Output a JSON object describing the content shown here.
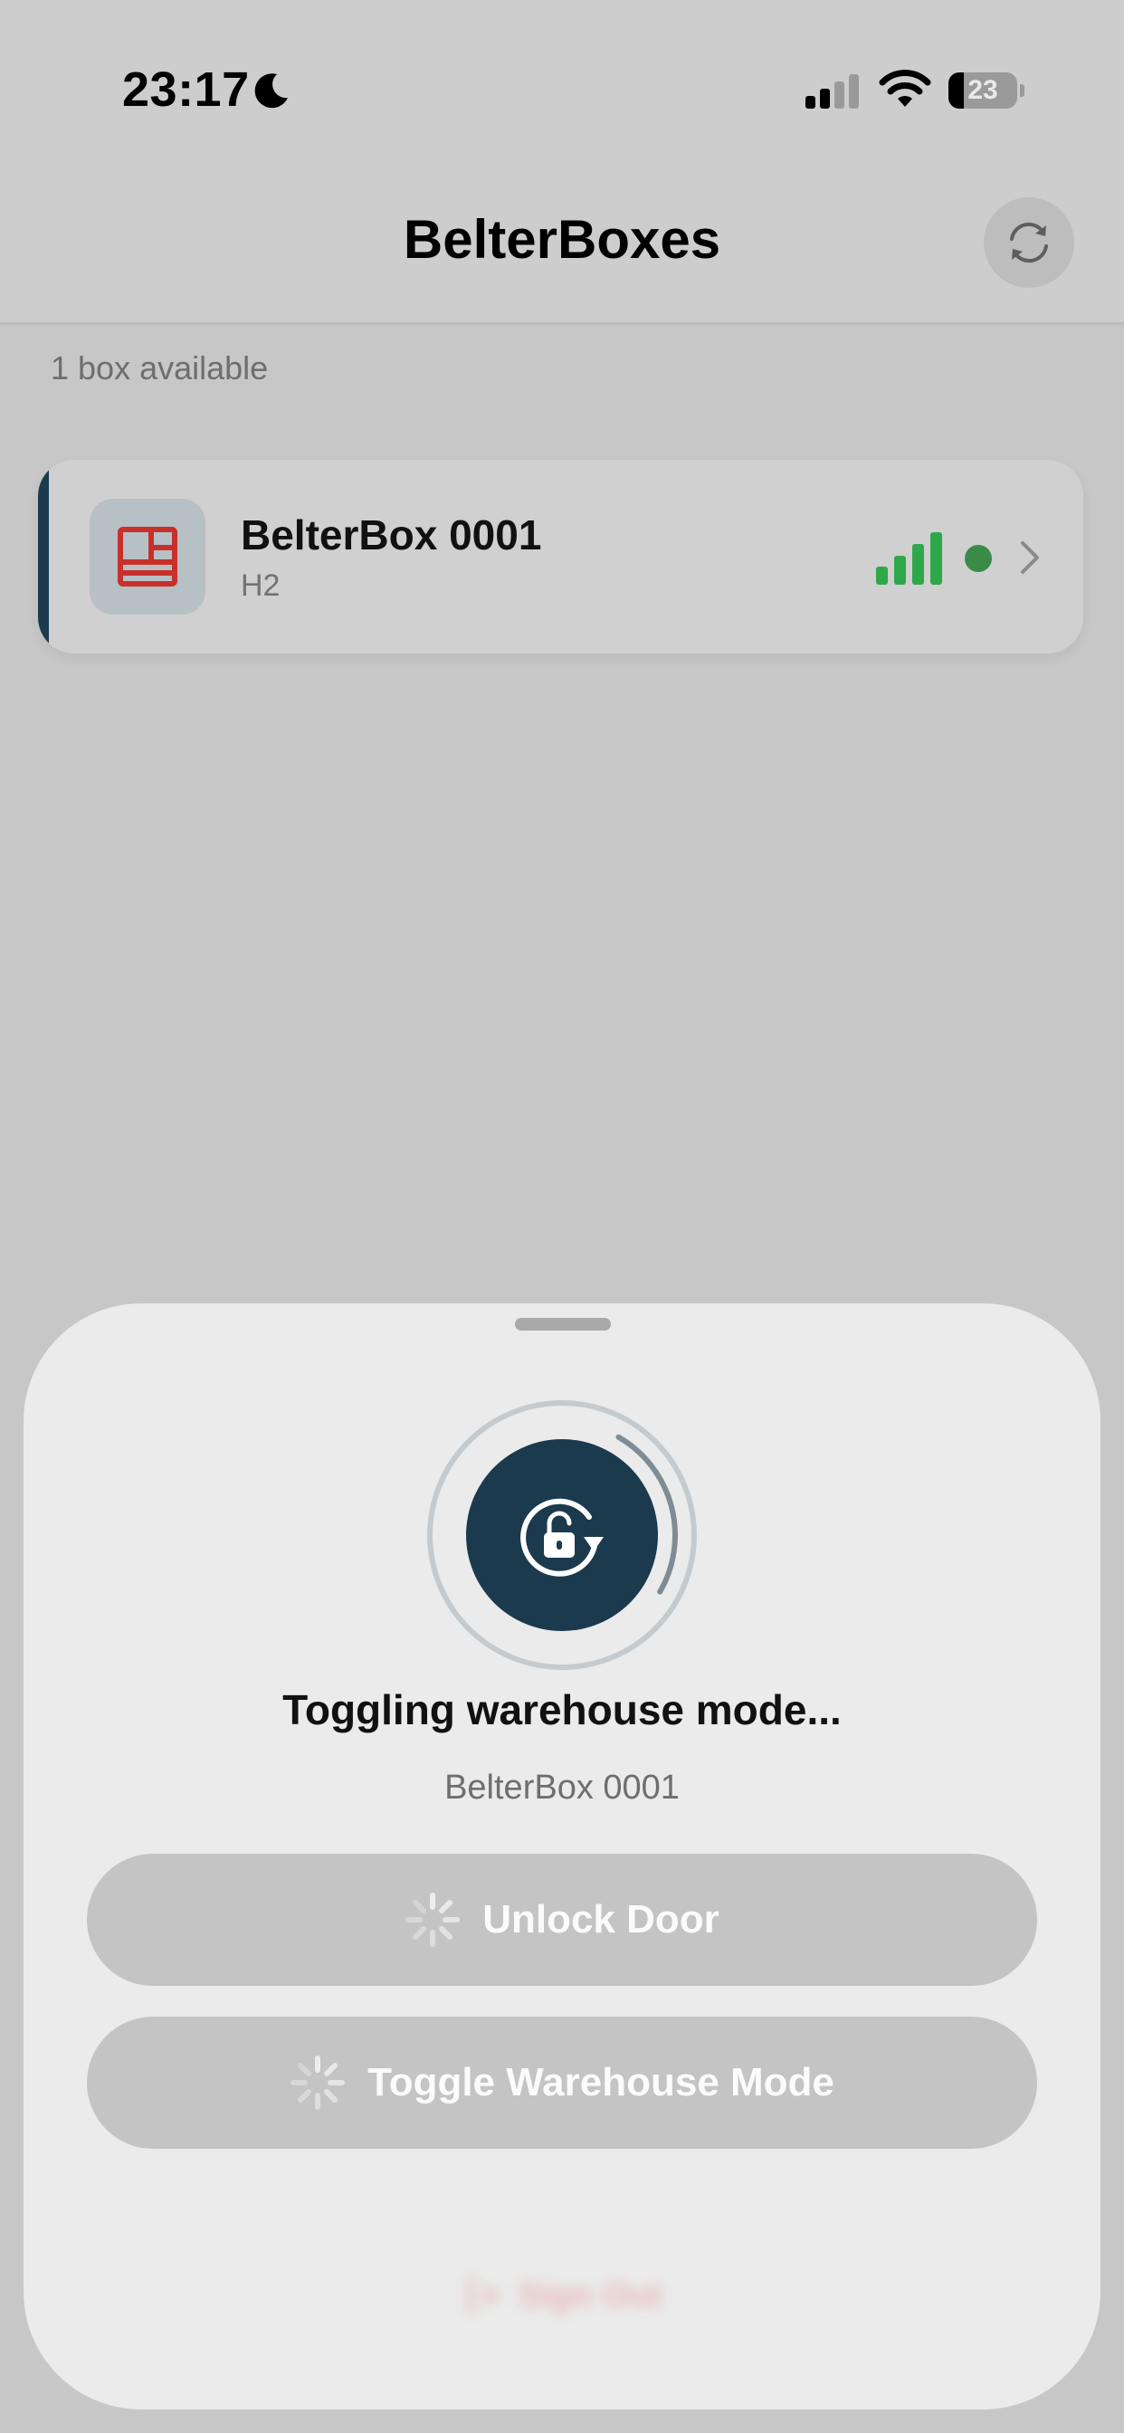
{
  "status_bar": {
    "time": "23:17",
    "battery": "23",
    "battery_fraction": 0.23,
    "cell_bars_active": 2,
    "cell_bars_total": 4
  },
  "header": {
    "title": "BelterBoxes",
    "refresh_icon": "refresh-icon"
  },
  "list": {
    "count_text": "1 box available",
    "boxes": [
      {
        "name": "BelterBox 0001",
        "model": "H2",
        "icon": "box-layout-icon",
        "signal_bars": 4,
        "signal_bars_total": 4,
        "online": true
      }
    ]
  },
  "sheet": {
    "status_text": "Toggling warehouse mode...",
    "device_name": "BelterBox 0001",
    "progress": 0.25,
    "unlock_label": "Unlock Door",
    "warehouse_label": "Toggle Warehouse Mode",
    "sign_out_label": "Sign Out"
  },
  "colors": {
    "accent": "#1c3a4e",
    "signal_green": "#2ea84a",
    "online_dot": "#3a8a48",
    "box_icon_red": "#c8302c",
    "sign_out_red": "#e25b5b",
    "disabled_button": "#c4c4c4"
  }
}
